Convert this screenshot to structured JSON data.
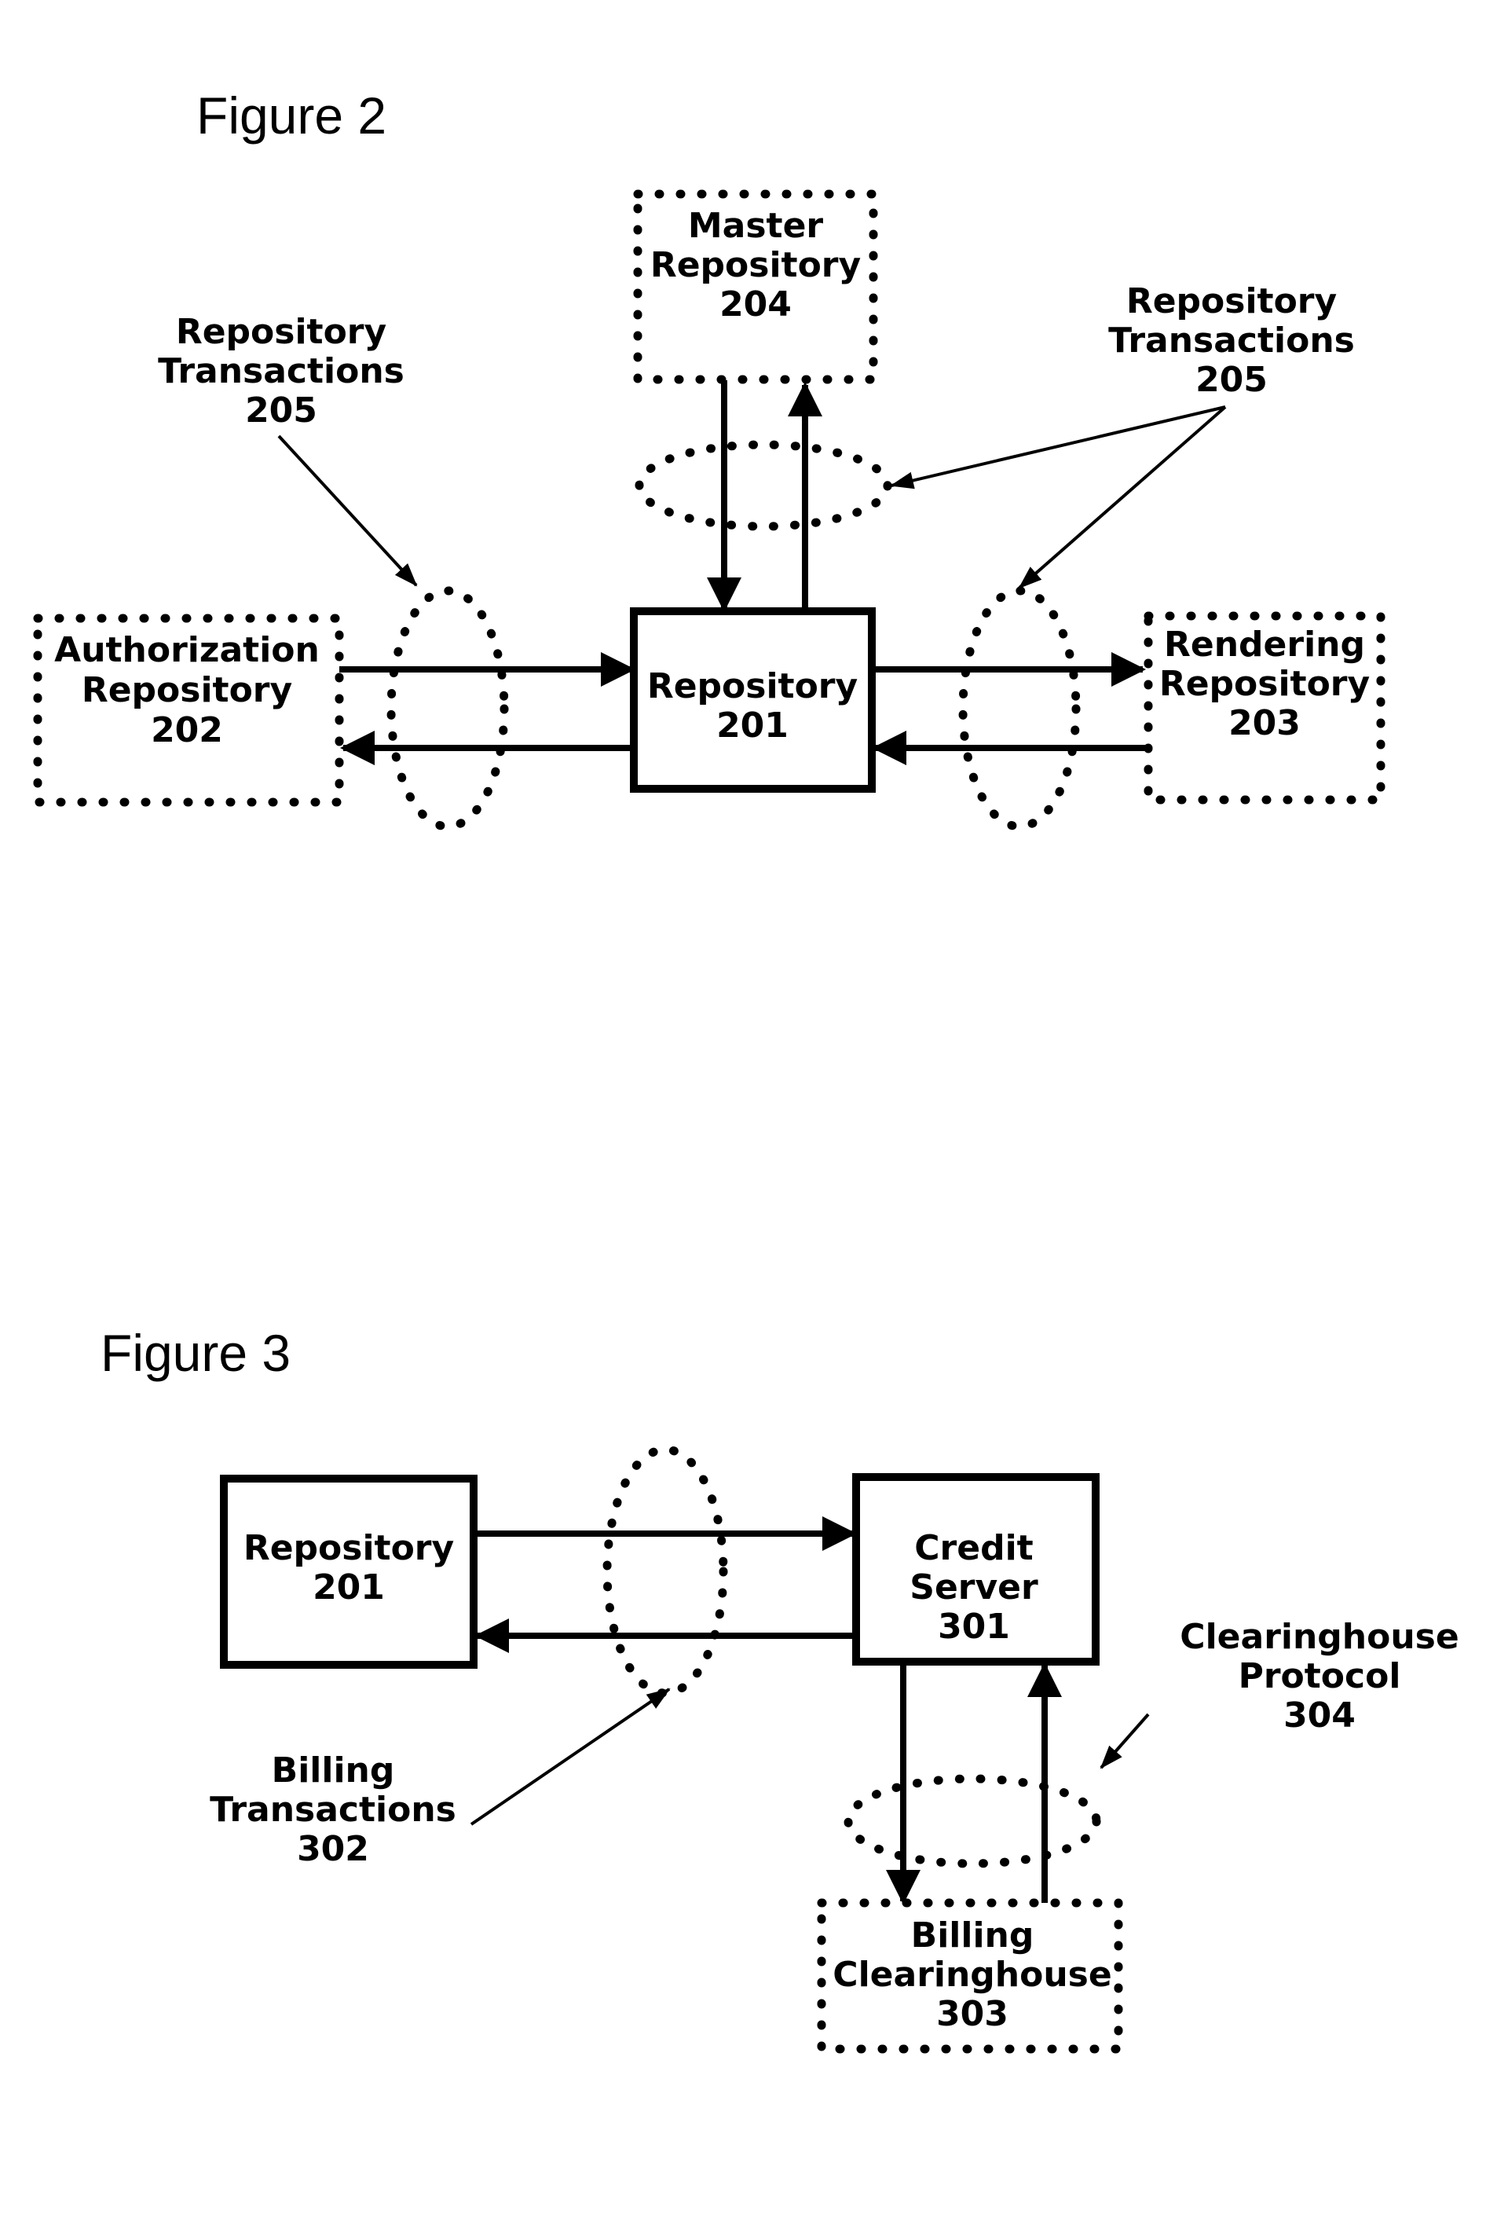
{
  "figure2": {
    "title": "Figure 2",
    "nodes": {
      "master": [
        "Master",
        "Repository",
        "204"
      ],
      "repository": [
        "Repository",
        "201"
      ],
      "authorization": [
        "Authorization",
        "Repository",
        "202"
      ],
      "rendering": [
        "Rendering",
        "Repository",
        "203"
      ]
    },
    "callout_left": [
      "Repository",
      "Transactions",
      "205"
    ],
    "callout_right": [
      "Repository",
      "Transactions",
      "205"
    ]
  },
  "figure3": {
    "title": "Figure 3",
    "nodes": {
      "repository": [
        "Repository",
        "201"
      ],
      "credit_server": [
        "Credit",
        "Server",
        "301"
      ],
      "billing_clearinghouse": [
        "Billing",
        "Clearinghouse",
        "303"
      ]
    },
    "callout_billing": [
      "Billing",
      "Transactions",
      "302"
    ],
    "callout_protocol": [
      "Clearinghouse",
      "Protocol",
      "304"
    ]
  }
}
